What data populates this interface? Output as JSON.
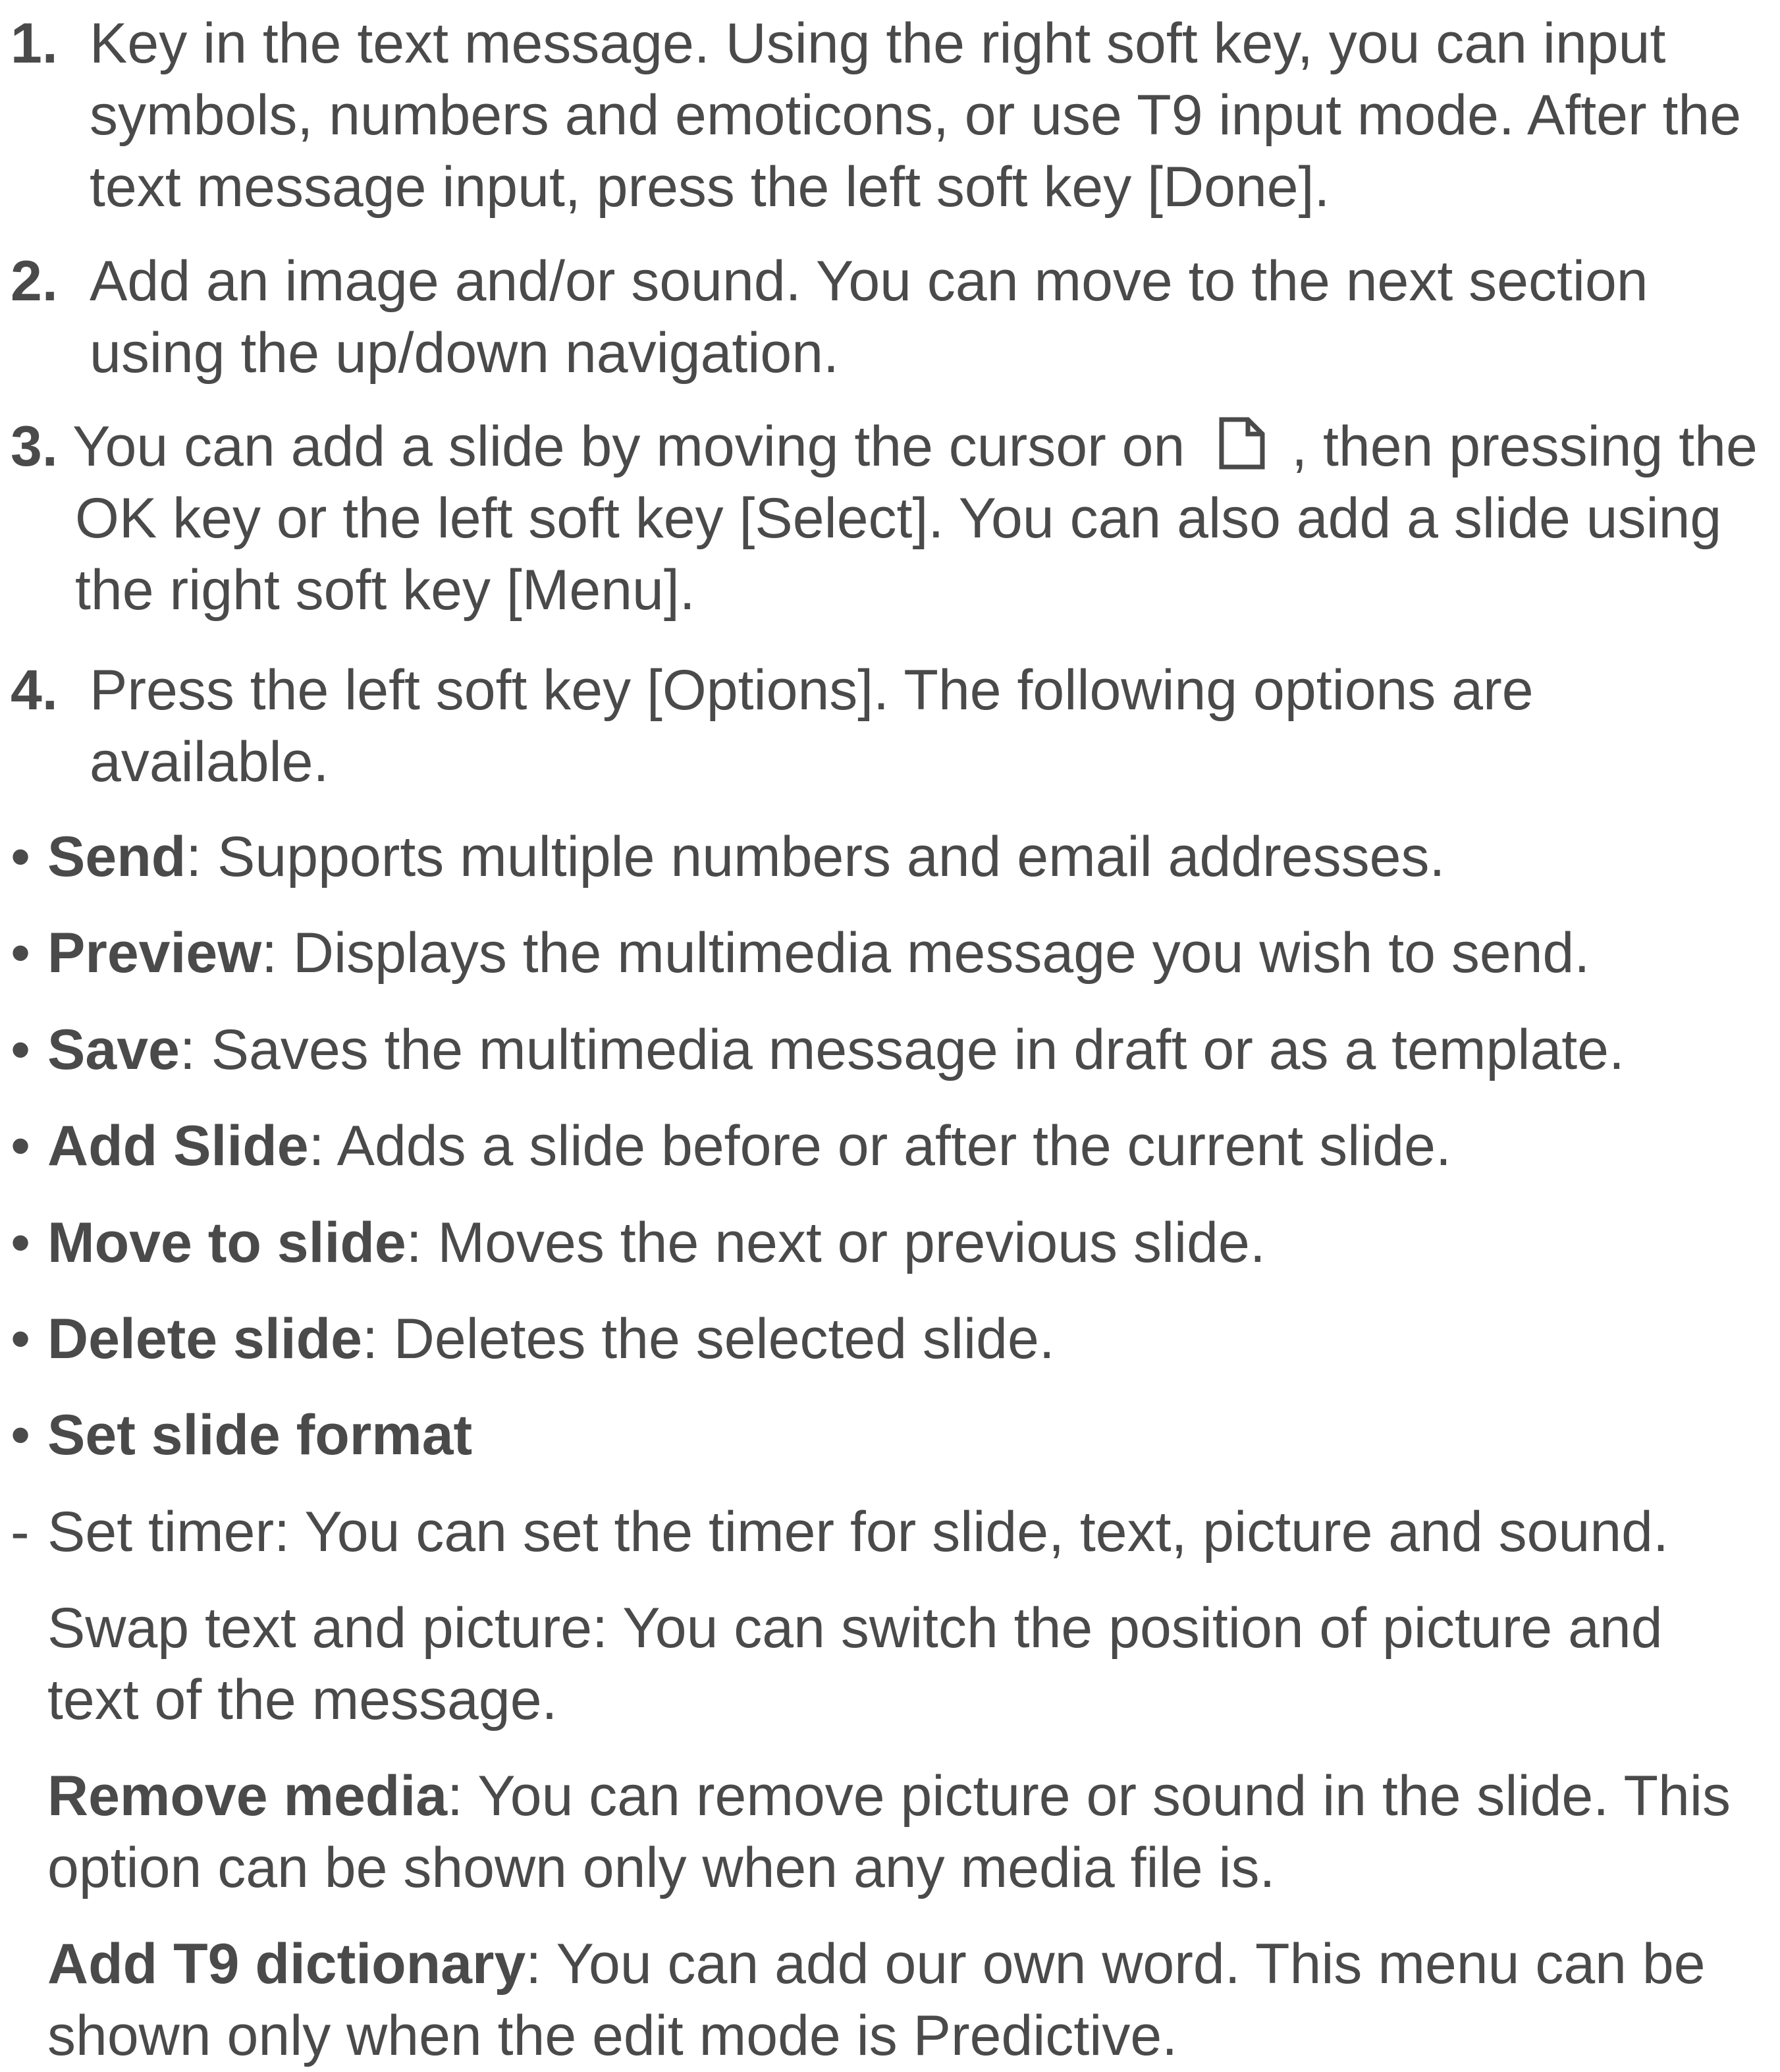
{
  "steps": [
    {
      "num": "1.",
      "text": "Key in the text message. Using the right soft key, you can input symbols, numbers and emoticons, or use T9 input mode. After the text message input, press the left soft key [Done]."
    },
    {
      "num": "2.",
      "text": "Add an image and/or sound. You can move to the next section using the up/down navigation."
    },
    {
      "num": "3.",
      "text_before_icon": "You can add a slide by moving the cursor on",
      "icon": "new-slide-icon",
      "text_after_icon": ", then pressing the OK key or the left soft key [Select]. You can also add a slide using the right soft key [Menu]."
    },
    {
      "num": "4.",
      "text": "Press the left soft key [Options]. The following options are available."
    }
  ],
  "options": [
    {
      "marker": "•",
      "term": "Send",
      "desc": ": Supports multiple numbers and email addresses."
    },
    {
      "marker": "•",
      "term": "Preview",
      "desc": ": Displays the multimedia message you wish to send."
    },
    {
      "marker": "•",
      "term": "Save",
      "desc": ": Saves the multimedia message in draft or as a template."
    },
    {
      "marker": "•",
      "term": "Add Slide",
      "desc": ": Adds a slide before or after the current slide."
    },
    {
      "marker": "•",
      "term": "Move to slide",
      "desc": ": Moves the next or previous slide."
    },
    {
      "marker": "•",
      "term": "Delete slide",
      "desc": ": Deletes the selected slide."
    },
    {
      "marker": "•",
      "term": "Set slide format",
      "desc": ""
    },
    {
      "marker": "-",
      "term": "",
      "desc": "Set timer: You can set the timer for slide, text, picture and sound."
    },
    {
      "marker": "-",
      "term": "",
      "desc": "Swap text and picture: You can switch the position of picture and text of the message."
    },
    {
      "marker": "•",
      "term": "Remove media",
      "desc": ": You can remove picture or sound in the slide. This option can be shown only when any media file is."
    },
    {
      "marker": "•",
      "term": "Add T9 dictionary",
      "desc": ": You can add our own word. This menu can be shown only when the edit mode is Predictive."
    }
  ]
}
